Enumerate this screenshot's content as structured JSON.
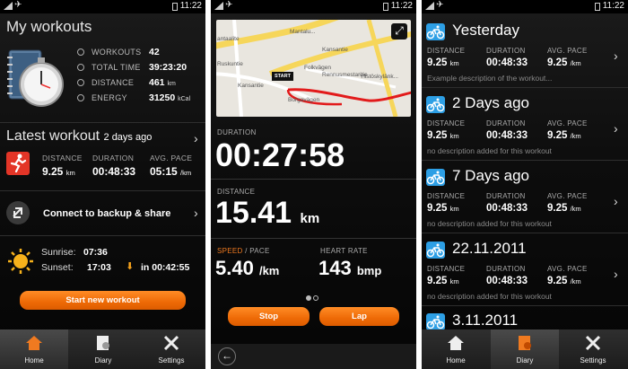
{
  "status": {
    "time": "11:22"
  },
  "panel1": {
    "title": "My workouts",
    "stats": [
      {
        "label": "WORKOUTS",
        "value": "42",
        "unit": ""
      },
      {
        "label": "TOTAL TIME",
        "value": "39:23:20",
        "unit": ""
      },
      {
        "label": "DISTANCE",
        "value": "461",
        "unit": "km"
      },
      {
        "label": "ENERGY",
        "value": "31250",
        "unit": "kCal"
      }
    ],
    "latest": {
      "title": "Latest workout",
      "when": "2 days ago",
      "distance_label": "DISTANCE",
      "distance": "9.25",
      "distance_unit": "km",
      "duration_label": "DURATION",
      "duration": "00:48:33",
      "pace_label": "AVG. PACE",
      "pace": "05:15",
      "pace_unit": "/km"
    },
    "backup_label": "Connect to backup & share",
    "sun": {
      "sunrise_label": "Sunrise:",
      "sunrise": "07:36",
      "sunset_label": "Sunset:",
      "sunset": "17:03",
      "countdown": "in 00:42:55"
    },
    "start_button": "Start new workout"
  },
  "toolbar": {
    "home": "Home",
    "diary": "Diary",
    "settings": "Settings"
  },
  "panel2": {
    "map_labels": [
      "Mantalu...",
      "Kansantie",
      "antaalite",
      "Ruskuntie",
      "Folkvägen",
      "Kansantie",
      "Rennusmestaritie",
      "Borgavägen",
      "Ylistöskylänk..."
    ],
    "start_flag": "START",
    "duration_label": "DURATION",
    "duration": "00:27:58",
    "distance_label": "DISTANCE",
    "distance": "15.41",
    "distance_unit": "km",
    "speed_label": "SPEED",
    "pace_label": "/ PACE",
    "pace": "5.40",
    "pace_unit": "/km",
    "hr_label": "HEART RATE",
    "hr": "143",
    "hr_unit": "bmp",
    "stop": "Stop",
    "lap": "Lap"
  },
  "panel3": {
    "entries": [
      {
        "title": "Yesterday",
        "distance": "9.25",
        "duration": "00:48:33",
        "pace": "9.25",
        "desc": "Example description of the workout..."
      },
      {
        "title": "2 Days ago",
        "distance": "9.25",
        "duration": "00:48:33",
        "pace": "9.25",
        "desc": "no description added for this workout"
      },
      {
        "title": "7 Days ago",
        "distance": "9.25",
        "duration": "00:48:33",
        "pace": "9.25",
        "desc": "no description added for this workout"
      },
      {
        "title": "22.11.2011",
        "distance": "9.25",
        "duration": "00:48:33",
        "pace": "9.25",
        "desc": "no description added for this workout"
      },
      {
        "title": "3.11.2011"
      }
    ],
    "labels": {
      "distance": "DISTANCE",
      "duration": "DURATION",
      "pace": "AVG. PACE",
      "km": "km",
      "per_km": "/km"
    }
  }
}
